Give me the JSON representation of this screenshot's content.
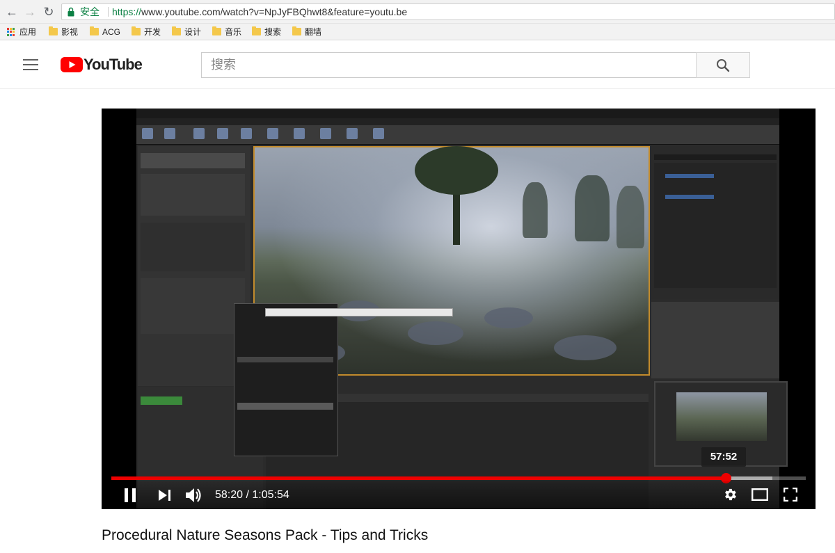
{
  "browser": {
    "secure_label": "安全",
    "url_scheme": "https://",
    "url_rest": "www.youtube.com/watch?v=NpJyFBQhwt8&feature=youtu.be",
    "bookmarks": [
      "应用",
      "影视",
      "ACG",
      "开发",
      "设计",
      "音乐",
      "搜索",
      "翻墙"
    ]
  },
  "youtube": {
    "logo_text": "YouTube",
    "search_placeholder": "搜索"
  },
  "player": {
    "current_time": "58:20",
    "duration": "1:05:54",
    "time_display": "58:20 / 1:05:54",
    "preview_time": "57:52",
    "played_fraction": 0.885,
    "buffered_fraction": 0.952
  },
  "video": {
    "title": "Procedural Nature Seasons Pack - Tips and Tricks"
  },
  "colors": {
    "youtube_red": "#ff0000",
    "progress_red": "#ee0000",
    "secure_green": "#0b8043",
    "bookmark_folder": "#f4c84b"
  },
  "icons": [
    "back-icon",
    "forward-icon",
    "reload-icon",
    "lock-icon",
    "apps-icon",
    "folder-icon",
    "hamburger-menu-icon",
    "youtube-logo-icon",
    "search-icon",
    "pause-icon",
    "next-icon",
    "volume-icon",
    "settings-gear-icon",
    "theater-mode-icon",
    "fullscreen-icon"
  ]
}
